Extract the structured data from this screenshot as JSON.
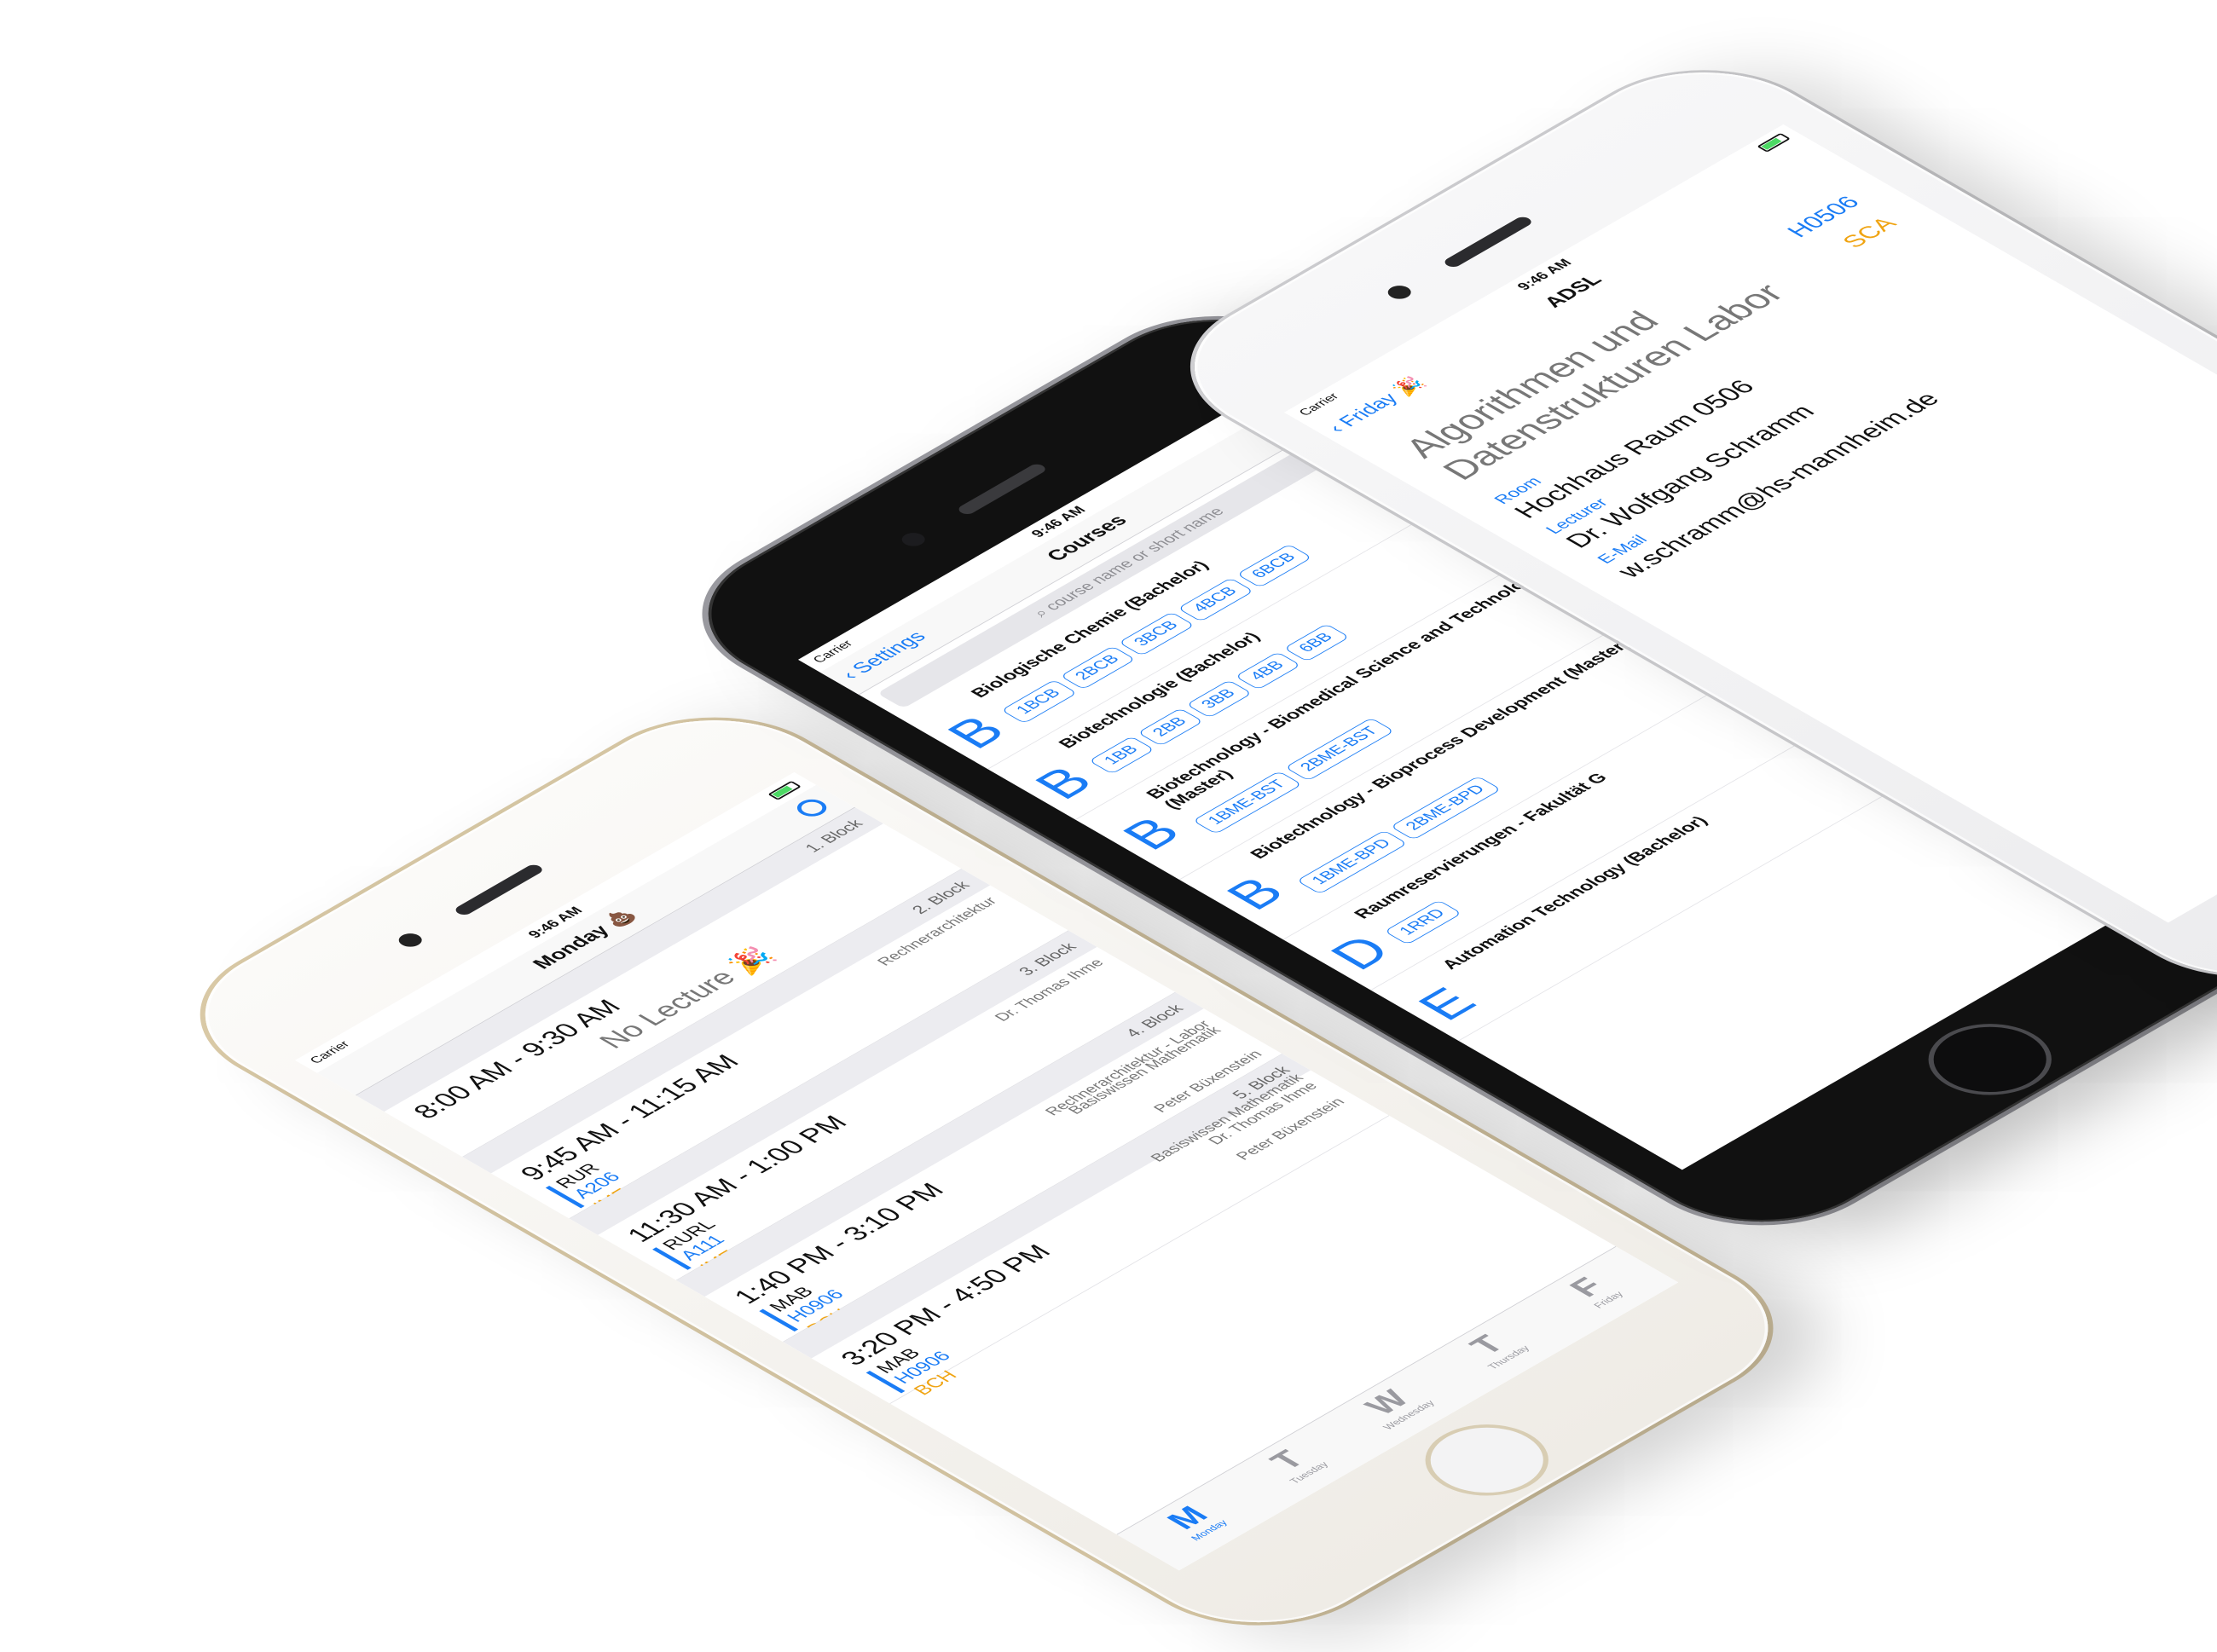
{
  "phone_schedule": {
    "status": {
      "carrier": "Carrier",
      "time": "9:46 AM"
    },
    "nav_title": "Monday 💩",
    "settings_icon": "gear-icon",
    "blocks": [
      {
        "head": "1. Block",
        "time": "8:00 AM - 9:30 AM",
        "no_lecture": "No Lecture 🎉",
        "lecturer": "",
        "course": "",
        "room": "",
        "short": ""
      },
      {
        "head": "2. Block",
        "time": "9:45 AM - 11:15 AM",
        "no_lecture": "",
        "lecturer": "Rechnerarchitektur",
        "course": "RUR",
        "room": "A206",
        "short": "IME"
      },
      {
        "head": "3. Block",
        "time": "11:30 AM - 1:00 PM",
        "no_lecture": "",
        "lecturer": "Dr. Thomas Ihme",
        "course": "RURL",
        "room": "A111",
        "short": "IME"
      },
      {
        "head": "4. Block",
        "time": "1:40 PM - 3:10 PM",
        "no_lecture": "",
        "lecturer": "Rechnerarchitektur - Labor",
        "course": "MAB",
        "room": "H0906",
        "short": "BCH"
      },
      {
        "head": "5. Block",
        "time": "3:20 PM - 4:50 PM",
        "no_lecture": "",
        "lecturer": "Dr. Thomas Ihme",
        "course": "MAB",
        "room": "H0906",
        "short": "BCH"
      }
    ],
    "extra_lecturers": [
      "Basiswissen Mathematik",
      "Peter Büxenstein",
      "Basiswissen Mathematik",
      "Peter Büxenstein"
    ],
    "tabs": [
      {
        "letter": "M",
        "label": "Monday"
      },
      {
        "letter": "T",
        "label": "Tuesday"
      },
      {
        "letter": "W",
        "label": "Wednesday"
      },
      {
        "letter": "T",
        "label": "Thursday"
      },
      {
        "letter": "F",
        "label": "Friday"
      }
    ]
  },
  "phone_courses": {
    "status": {
      "carrier": "Carrier",
      "time": "9:46 AM"
    },
    "back_label": "Settings",
    "nav_title": "Courses",
    "search_placeholder": "course name or short name",
    "courses": [
      {
        "letter": "B",
        "name": "Biologische Chemie (Bachelor)",
        "tags": [
          "1BCB",
          "2BCB",
          "3BCB",
          "4BCB",
          "6BCB"
        ]
      },
      {
        "letter": "B",
        "name": "Biotechnologie (Bachelor)",
        "tags": [
          "1BB",
          "2BB",
          "3BB",
          "4BB",
          "6BB"
        ]
      },
      {
        "letter": "B",
        "name": "Biotechnology - Biomedical Science and Technology (Master)",
        "tags": [
          "1BME-BST",
          "2BME-BST"
        ]
      },
      {
        "letter": "B",
        "name": "Biotechnology - Bioprocess Development (Master)",
        "tags": [
          "1BME-BPD",
          "2BME-BPD"
        ]
      },
      {
        "letter": "D",
        "name": "Raumreservierungen - Fakultät G",
        "tags": [
          "1RRD"
        ]
      },
      {
        "letter": "E",
        "name": "Automation Technology (Bachelor)",
        "tags": []
      }
    ]
  },
  "phone_detail": {
    "status": {
      "carrier": "Carrier",
      "time": "9:46 AM"
    },
    "back_label": "Friday 🎉",
    "nav_title": "ADSL",
    "title": "Algorithmen und Datenstrukturen Labor",
    "room_code": "H0506",
    "short": "SCA",
    "fields": [
      {
        "label": "Room",
        "value": "Hochhaus Raum 0506"
      },
      {
        "label": "Lecturer",
        "value": "Dr. Wolfgang Schramm"
      },
      {
        "label": "E-Mail",
        "value": "w.schramm@hs-mannheim.de"
      }
    ]
  }
}
